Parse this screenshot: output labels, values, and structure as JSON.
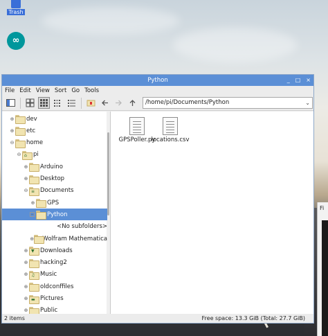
{
  "desktop": {
    "trash_label": "Trash"
  },
  "window": {
    "title": "Python",
    "controls": [
      "_",
      "□",
      "×"
    ]
  },
  "menu": [
    "File",
    "Edit",
    "View",
    "Sort",
    "Go",
    "Tools"
  ],
  "toolbar": {
    "path": "/home/pi/Documents/Python"
  },
  "tree": [
    {
      "label": "dev",
      "level": 0,
      "expander": "plus"
    },
    {
      "label": "etc",
      "level": 0,
      "expander": "plus"
    },
    {
      "label": "home",
      "level": 0,
      "expander": "minus"
    },
    {
      "label": "pi",
      "level": 1,
      "expander": "minus",
      "icon": "home"
    },
    {
      "label": "Arduino",
      "level": 2,
      "expander": "plus"
    },
    {
      "label": "Desktop",
      "level": 2,
      "expander": "plus"
    },
    {
      "label": "Documents",
      "level": 2,
      "expander": "minus",
      "icon": "docs"
    },
    {
      "label": "GPS",
      "level": 3,
      "expander": "plus"
    },
    {
      "label": "Python",
      "level": 3,
      "expander": "box",
      "selected": true
    },
    {
      "label": "<No subfolders>",
      "level": 4,
      "expander": "none",
      "noicon": true
    },
    {
      "label": "Wolfram Mathematica",
      "level": 3,
      "expander": "plus"
    },
    {
      "label": "Downloads",
      "level": 2,
      "expander": "plus",
      "icon": "download"
    },
    {
      "label": "hacking2",
      "level": 2,
      "expander": "plus"
    },
    {
      "label": "Music",
      "level": 2,
      "expander": "plus",
      "icon": "music"
    },
    {
      "label": "oldconffiles",
      "level": 2,
      "expander": "plus"
    },
    {
      "label": "Pictures",
      "level": 2,
      "expander": "plus",
      "icon": "pictures"
    },
    {
      "label": "Public",
      "level": 2,
      "expander": "plus"
    }
  ],
  "files": [
    {
      "name": "GPSPoller.py"
    },
    {
      "name": "locations.csv"
    }
  ],
  "status": {
    "items": "2 items",
    "free": "Free space: 13.3 GiB (Total: 27.7 GiB)"
  }
}
